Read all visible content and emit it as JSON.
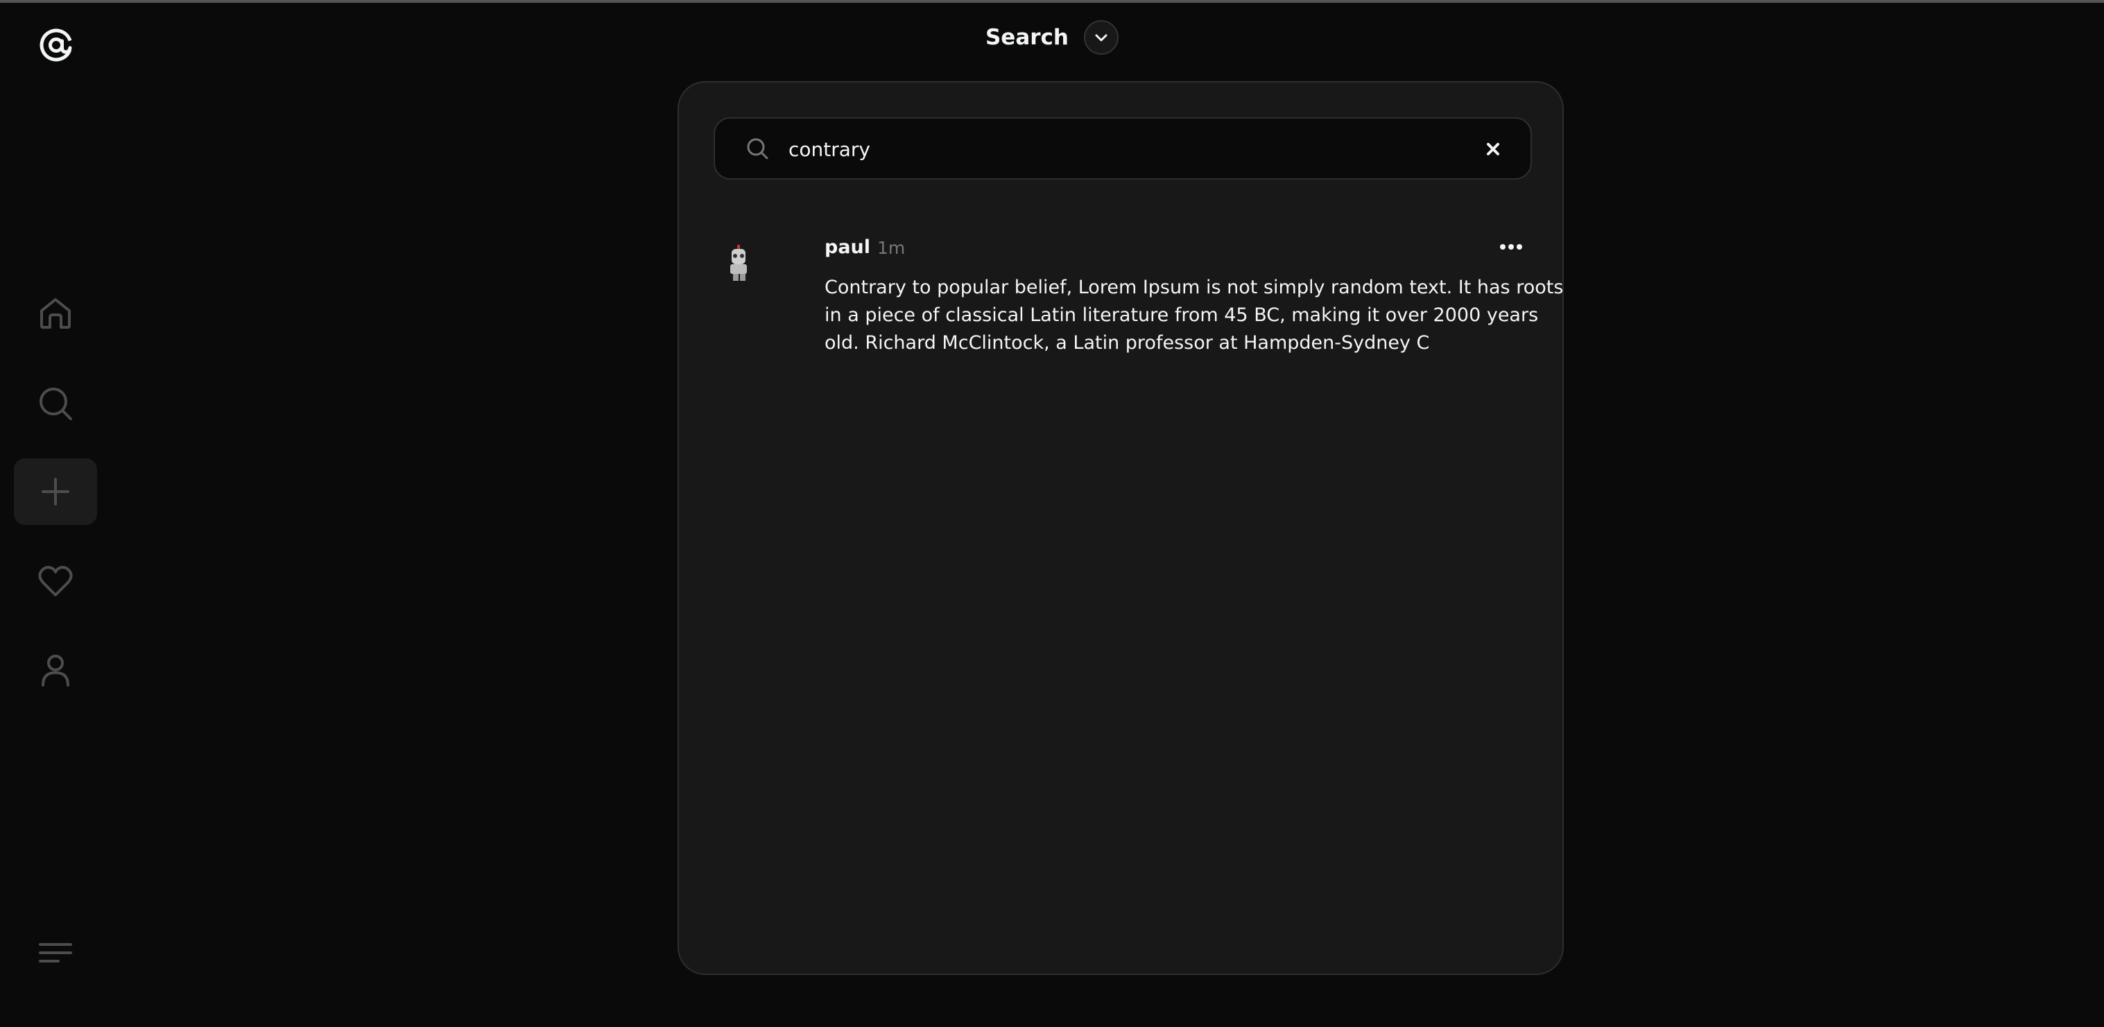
{
  "header": {
    "title": "Search"
  },
  "search": {
    "value": "contrary",
    "placeholder": "Search"
  },
  "sidebar": {
    "items": [
      {
        "name": "home",
        "icon": "home-icon"
      },
      {
        "name": "search",
        "icon": "search-icon"
      },
      {
        "name": "create",
        "icon": "plus-icon"
      },
      {
        "name": "activity",
        "icon": "heart-icon"
      },
      {
        "name": "profile",
        "icon": "person-icon"
      }
    ]
  },
  "results": [
    {
      "username": "paul",
      "time": "1m",
      "text": "Contrary to popular belief, Lorem Ipsum is not simply random text. It has roots in a piece of classical Latin literature from 45 BC, making it over 2000 years old. Richard McClintock, a Latin professor at Hampden-Sydney C"
    }
  ],
  "colors": {
    "background": "#0a0a0a",
    "panel": "#181818",
    "text": "#f3f5f7",
    "muted": "#777777"
  }
}
